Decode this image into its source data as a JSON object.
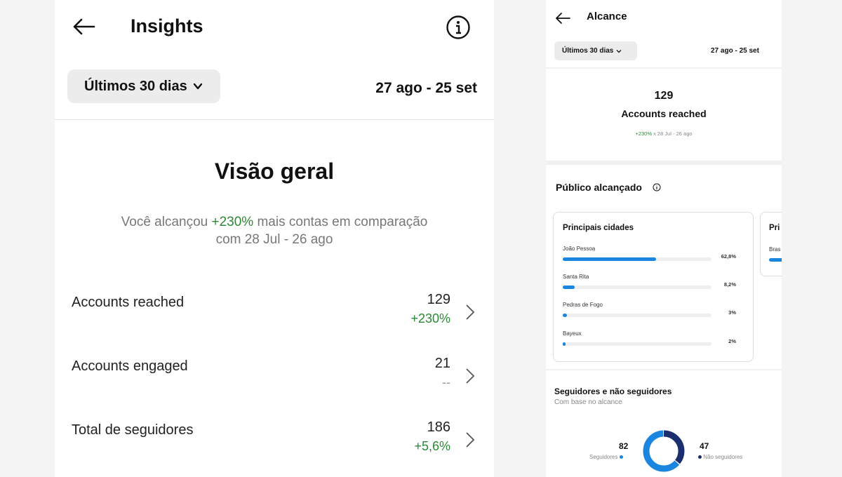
{
  "left": {
    "title": "Insights",
    "range_label": "Últimos 30 dias",
    "date_range": "27 ago - 25 set",
    "overview_title": "Visão geral",
    "overview_sub_before": "Você alcançou ",
    "overview_sub_highlight": "+230%",
    "overview_sub_after": " mais contas em comparação",
    "overview_sub_line2": "com 28 Jul - 26 ago",
    "metrics": [
      {
        "label": "Accounts reached",
        "value": "129",
        "delta": "+230%"
      },
      {
        "label": "Accounts engaged",
        "value": "21",
        "delta": "--"
      },
      {
        "label": "Total de seguidores",
        "value": "186",
        "delta": "+5,6%"
      }
    ]
  },
  "right": {
    "title": "Alcance",
    "range_label": "Últimos 30 dias",
    "date_range": "27 ago - 25 set",
    "reach_value": "129",
    "reach_label": "Accounts reached",
    "reach_delta": "+230%",
    "reach_compare": " x 28 Jul - 26 ago",
    "audience_title": "Público alcançado",
    "cities_card_title": "Principais cidades",
    "cities": [
      {
        "name": "João Pessoa",
        "pct": "62,8%",
        "fraction": 0.628
      },
      {
        "name": "Santa Rita",
        "pct": "8,2%",
        "fraction": 0.082
      },
      {
        "name": "Pedras de Fogo",
        "pct": "3%",
        "fraction": 0.03
      },
      {
        "name": "Bayeux",
        "pct": "2%",
        "fraction": 0.02
      }
    ],
    "second_card_title": "Pri",
    "second_card_item": "Bras",
    "followers_title": "Seguidores e não seguidores",
    "followers_sub": "Com base no alcance",
    "followers_count": "82",
    "followers_label": "Seguidores",
    "non_followers_count": "47",
    "non_followers_label": "Não seguidores",
    "followers_color": "#1a86e0",
    "non_followers_color": "#1b2f6e"
  },
  "colors": {
    "positive": "#2a8a34",
    "accent_blue": "#1a86e0"
  }
}
